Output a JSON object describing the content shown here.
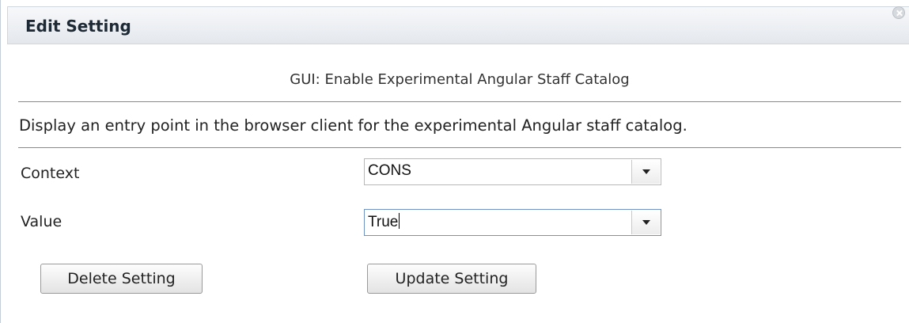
{
  "dialog": {
    "title": "Edit Setting"
  },
  "setting": {
    "name": "GUI: Enable Experimental Angular Staff Catalog",
    "description": "Display an entry point in the browser client for the experimental Angular staff catalog."
  },
  "fields": {
    "context": {
      "label": "Context",
      "selected": "CONS"
    },
    "value": {
      "label": "Value",
      "selected": "True"
    }
  },
  "buttons": {
    "delete_label": "Delete Setting",
    "update_label": "Update Setting"
  },
  "icons": {
    "close": "close-icon",
    "dropdown": "chevron-down-icon"
  }
}
